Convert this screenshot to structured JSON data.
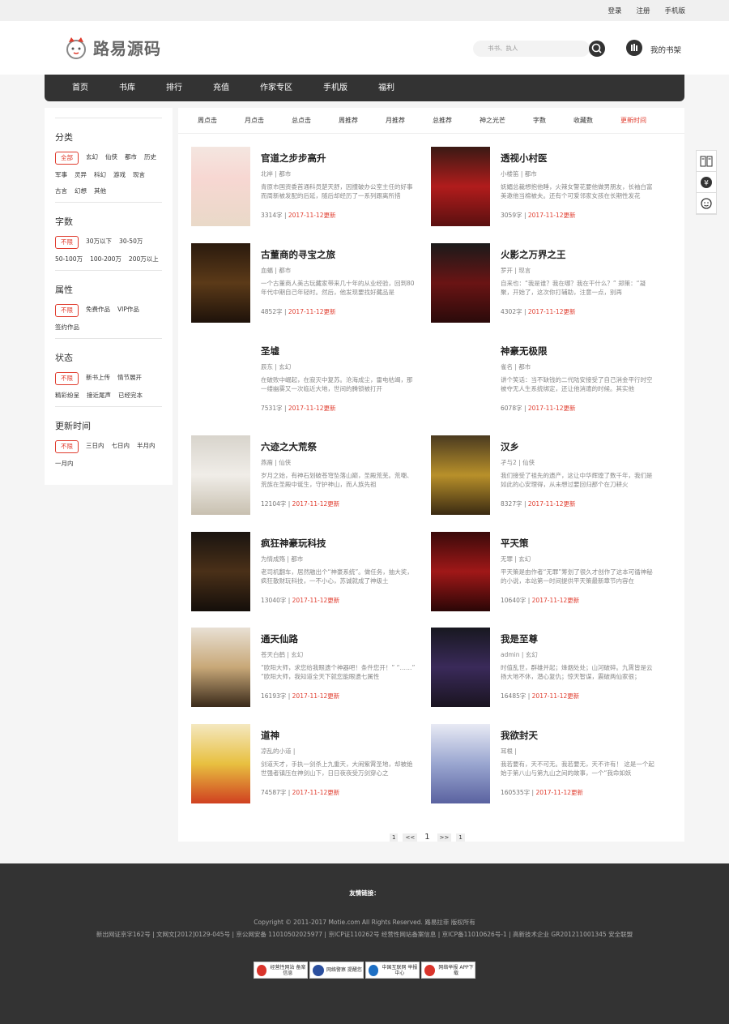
{
  "topbar": {
    "login": "登录",
    "register": "注册",
    "mobile": "手机版"
  },
  "header": {
    "logo_text": "路易源码",
    "search_placeholder": "书书、执人",
    "shelf": "我的书架"
  },
  "nav": [
    "首页",
    "书库",
    "排行",
    "充值",
    "作家专区",
    "手机版",
    "福利"
  ],
  "sidebar": {
    "category": {
      "title": "分类",
      "options": [
        "全部",
        "玄幻",
        "仙侠",
        "都市",
        "历史",
        "军事",
        "灵异",
        "科幻",
        "游戏",
        "现言",
        "古言",
        "幻想",
        "其他"
      ]
    },
    "words": {
      "title": "字数",
      "options": [
        "不限",
        "30万以下",
        "30-50万",
        "50-100万",
        "100-200万",
        "200万以上"
      ]
    },
    "attr": {
      "title": "属性",
      "options": [
        "不限",
        "免费作品",
        "VIP作品",
        "签约作品"
      ]
    },
    "status": {
      "title": "状态",
      "options": [
        "不限",
        "新书上传",
        "情节展开",
        "精彩纷呈",
        "接近尾声",
        "已经完本"
      ]
    },
    "update": {
      "title": "更新时间",
      "options": [
        "不限",
        "三日内",
        "七日内",
        "半月内",
        "一月内"
      ]
    }
  },
  "sort": [
    "周点击",
    "月点击",
    "总点击",
    "周推荐",
    "月推荐",
    "总推荐",
    "神之光芒",
    "字数",
    "收藏数",
    "更新时间"
  ],
  "books": [
    {
      "title": "官道之步步高升",
      "author": "北岸",
      "genre": "都市",
      "desc": "青原市国资委首通科员楚天舒，因撞破办公室主任的好事而周新被发配的后延，随后却经历了一系列跟离所措",
      "words": "3314字",
      "date": "2017-11-12更新"
    },
    {
      "title": "透视小村医",
      "author": "小楼笛",
      "genre": "都市",
      "desc": "妩媚总裁想抱他睡，火辣女警花要他做男朋友，长袖白富美邀他当棉被夫。还有个可爱邻家女孩在长期性发花",
      "words": "3059字",
      "date": "2017-11-12更新"
    },
    {
      "title": "古董商的寻宝之旅",
      "author": "血蝠",
      "genre": "都市",
      "desc": "一个古董商人美古玩藏家带来几十年的从业经验，回到80年代中期自己年轻时。然后，他发现要找好藏品是",
      "words": "4852字",
      "date": "2017-11-12更新"
    },
    {
      "title": "火影之万界之王",
      "author": "罗开",
      "genre": "现言",
      "desc": "自来也：“我是谁？我在哪？我在干什么？” 郑策：“凝聚，开始了，这次你打辅助，注意一点，别再",
      "words": "4302字",
      "date": "2017-11-12更新"
    },
    {
      "title": "圣墟",
      "author": "辰东",
      "genre": "玄幻",
      "desc": "在破败中崛起，在寂灭中复苏。沧海成尘，雷电枯竭，那一缕幽雾又一次临近大地，世间的腾锁被打开",
      "words": "7531字",
      "date": "2017-11-12更新"
    },
    {
      "title": "神豪无极限",
      "author": "雀名",
      "genre": "都市",
      "desc": "讲个笑话：当不缺钱的二代陆安接受了自己消金平行时空被夺无人生系统绑定，还让他消遣的时候。其实他",
      "words": "6078字",
      "date": "2017-11-12更新"
    },
    {
      "title": "六迹之大荒祭",
      "author": "燕裔",
      "genre": "仙侠",
      "desc": "岁月之始，有神石划破苍穹坠落山巅，圣殿荒芜。荒嘲、荒族在圣殿中诞生，守护神山，而人族先祖",
      "words": "12104字",
      "date": "2017-11-12更新"
    },
    {
      "title": "汉乡",
      "author": "孑与2",
      "genre": "仙侠",
      "desc": "我们接受了祖先的遗产，这让中华辉煌了数千年，我们是如此的心安理得，从未想过要回归那个在刀耕火",
      "words": "8327字",
      "date": "2017-11-12更新"
    },
    {
      "title": "疯狂神豪玩科技",
      "author": "为情成殇",
      "genre": "都市",
      "desc": "老司机翻车，居然融出个“神豪系统”。做任务，抽大奖，疯狂散财玩科技，一不小心，苏诚就成了神级土",
      "words": "13040字",
      "date": "2017-11-12更新"
    },
    {
      "title": "平天策",
      "author": "无罪",
      "genre": "玄幻",
      "desc": "平天策是由作者“无罪”筹划了很久才创作了这本可循神秘的小说，本站第一时间提供平天策最新章节内容在",
      "words": "10640字",
      "date": "2017-11-12更新"
    },
    {
      "title": "通天仙路",
      "author": "苍天白鹤",
      "genre": "玄幻",
      "desc": "“欧阳大师，求您给我眼遗个神器吧！条件您开！” “……” “欧阳大师，我知道全天下就您能眼遗七属性",
      "words": "16193字",
      "date": "2017-11-12更新"
    },
    {
      "title": "我是至尊",
      "author": "admin",
      "genre": "玄幻",
      "desc": "时值乱世，群雄并起；烽烟处处；山河破碎。九霄皆是云扬大地不休，潜心复仇；惊天智谋，震破两仙家很；",
      "words": "16485字",
      "date": "2017-11-12更新"
    },
    {
      "title": "道神",
      "author": "凉乱的小道",
      "genre": "",
      "desc": "剑道天才，手执一剑杀上九重天，大闹紫霄圣地，却被绝世强者镇压在神剑山下，日日夜夜受万剑穿心之",
      "words": "74587字",
      "date": "2017-11-12更新"
    },
    {
      "title": "我欲封天",
      "author": "耳根",
      "genre": "",
      "desc": "我若要有，天不可无。我若要无，天不许有！ 这是一个起始于第八山与第九山之间的故事，一个“我命如妖",
      "words": "160535字",
      "date": "2017-11-12更新"
    }
  ],
  "pager": {
    "first": "1",
    "prev": "<<",
    "current": "1",
    "next": ">>",
    "last": "1"
  },
  "footer": {
    "links": "友情链接：",
    "copyright": "Copyright © 2011-2017 Motie.com All Rights Reserved. 路易拉菲 版权所有",
    "licenses": "新出网证京字162号 | 文网文[2012]0129-045号 | 京公网安备 11010502025977 | 京ICP证110262号 经营性网站备案信息 | 京ICP备11010626号-1 | 高新技术企业 GR201211001345 安全联盟",
    "badges": [
      {
        "line1": "经营性网站",
        "line2": "备案信息",
        "color": "#d9342b"
      },
      {
        "line1": "网络警察",
        "line2": "提醒您",
        "color": "#2b4f9e"
      },
      {
        "line1": "中国互联网",
        "line2": "举报中心",
        "color": "#1d6fc4"
      },
      {
        "line1": "网络举报",
        "line2": "APP下载",
        "color": "#d9342b"
      }
    ]
  },
  "colors": {
    "accent": "#e03c2e",
    "dark": "#333333"
  }
}
